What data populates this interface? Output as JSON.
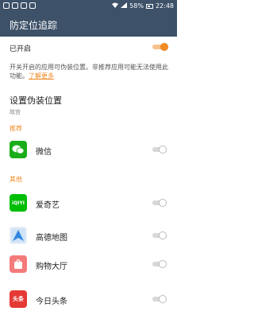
{
  "status_bar": {
    "battery": "58%",
    "time": "22:48"
  },
  "header": {
    "title": "防定位追踪"
  },
  "master": {
    "label": "已开启",
    "enabled": true
  },
  "description": {
    "text": "开关开启的应用可伪装位置。非推荐应用可能无法使用此功能。",
    "link": "了解更多"
  },
  "fake_location": {
    "title": "设置伪装位置",
    "subtitle": "故宫"
  },
  "sections": {
    "recommended": "推荐",
    "others": "其他"
  },
  "apps": [
    {
      "name": "微信",
      "enabled": false,
      "icon": "wechat-icon",
      "icon_bg": "#1aad19"
    },
    {
      "name": "爱奇艺",
      "enabled": false,
      "icon": "iqiyi-icon",
      "icon_bg": "#00be06",
      "icon_text": "iQIYI"
    },
    {
      "name": "高德地图",
      "enabled": false,
      "icon": "amap-icon",
      "icon_bg": "#4a90e2"
    },
    {
      "name": "购物大厅",
      "enabled": false,
      "icon": "shopping-bag-icon",
      "icon_bg": "#f26b6b"
    },
    {
      "name": "今日头条",
      "enabled": false,
      "icon": "toutiao-icon",
      "icon_bg": "#e53935",
      "icon_text": "头条"
    }
  ],
  "colors": {
    "header_bg": "#3d5168",
    "accent": "#f08a23"
  }
}
